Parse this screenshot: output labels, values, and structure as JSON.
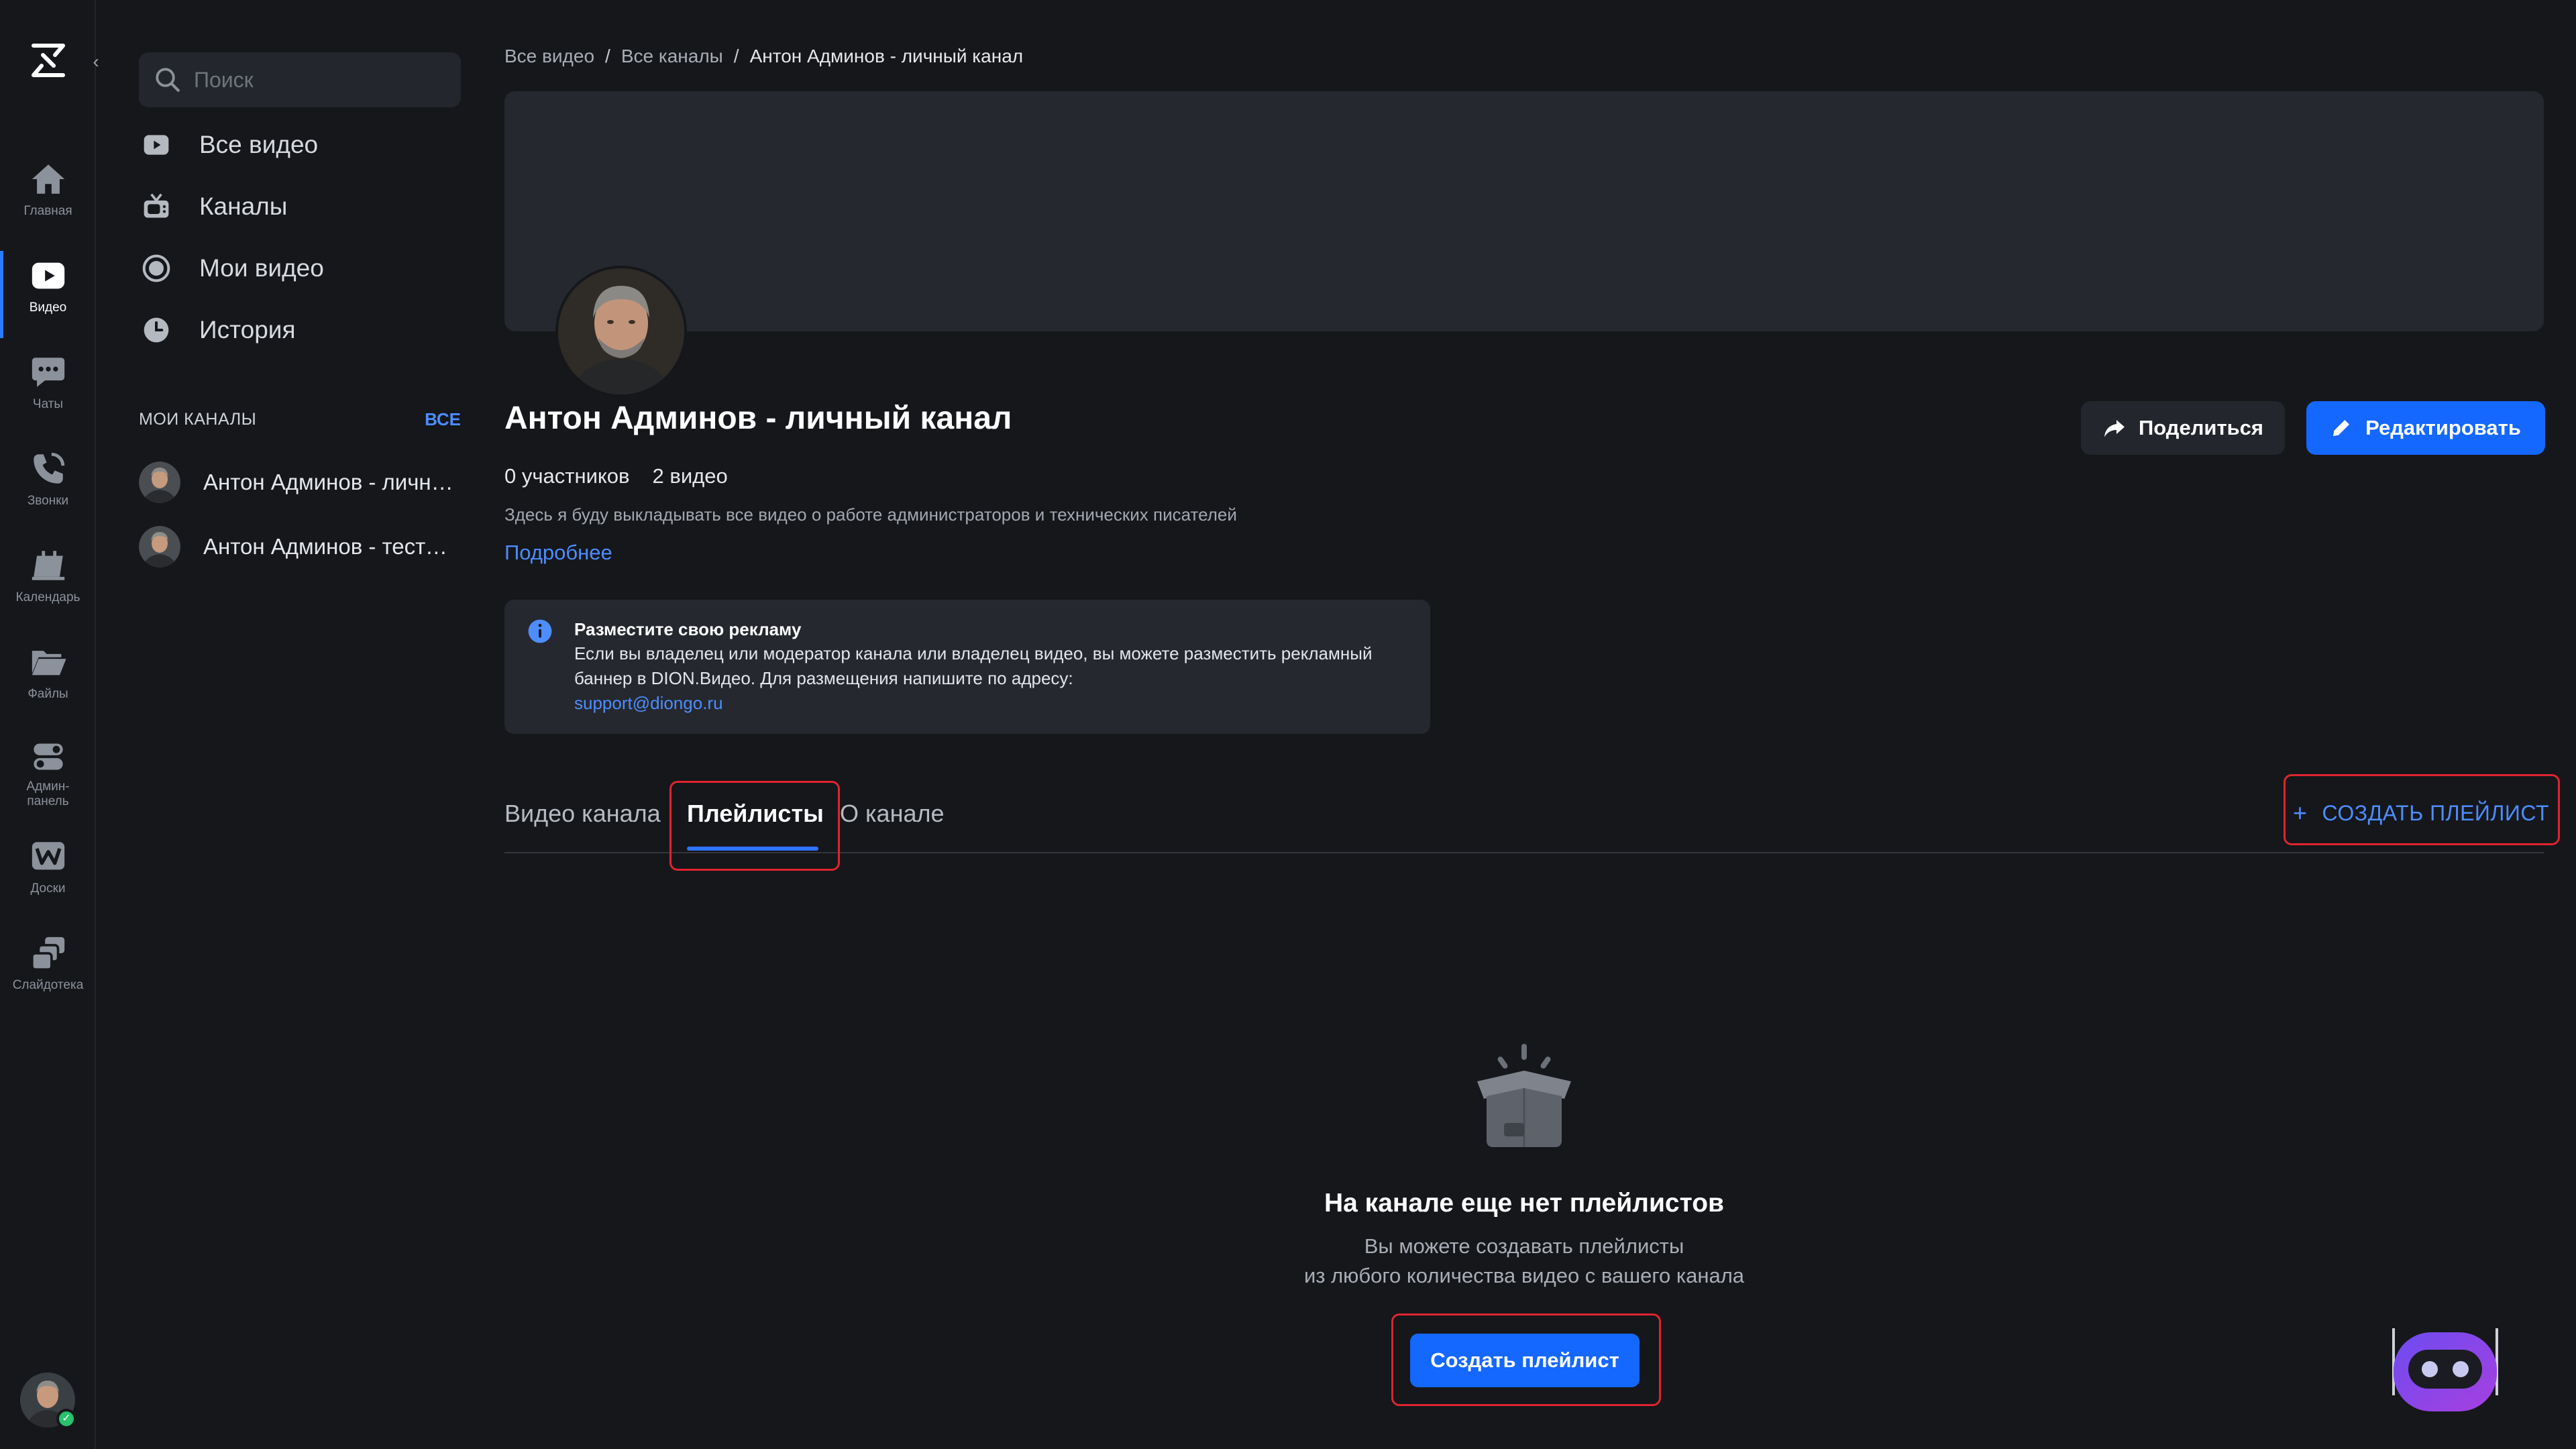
{
  "rail": {
    "items": [
      {
        "label": "Главная",
        "icon": "home-icon"
      },
      {
        "label": "Видео",
        "icon": "video-icon",
        "active": true
      },
      {
        "label": "Чаты",
        "icon": "chat-icon"
      },
      {
        "label": "Звонки",
        "icon": "phone-icon"
      },
      {
        "label": "Календарь",
        "icon": "calendar-icon"
      },
      {
        "label": "Файлы",
        "icon": "folder-icon"
      },
      {
        "label": "Админ-\nпанель",
        "icon": "toggles-icon"
      },
      {
        "label": "Доски",
        "icon": "whiteboard-icon"
      },
      {
        "label": "Слайдотека",
        "icon": "slides-icon"
      }
    ]
  },
  "sidebar": {
    "search_placeholder": "Поиск",
    "nav": [
      {
        "label": "Все видео",
        "icon": "play-square-icon"
      },
      {
        "label": "Каналы",
        "icon": "tv-icon"
      },
      {
        "label": "Мои видео",
        "icon": "record-icon"
      },
      {
        "label": "История",
        "icon": "clock-icon"
      }
    ],
    "my_channels_title": "МОИ КАНАЛЫ",
    "my_channels_all": "ВСЕ",
    "channels": [
      {
        "name": "Антон Админов - личный канал"
      },
      {
        "name": "Антон Админов - тестовый канал"
      }
    ]
  },
  "breadcrumb": [
    "Все видео",
    "Все каналы",
    "Антон Админов - личный канал"
  ],
  "channel": {
    "title": "Антон Админов - личный канал",
    "members": "0 участников",
    "videos": "2 видео",
    "description": "Здесь я буду выкладывать все видео о работе администраторов и технических писателей",
    "more": "Подробнее",
    "share_label": "Поделиться",
    "edit_label": "Редактировать"
  },
  "ad": {
    "title": "Разместите свою рекламу",
    "text": "Если вы владелец или модератор канала или владелец видео, вы можете разместить рекламный баннер в DION.Видео. Для размещения напишите по адресу:",
    "email": "support@diongo.ru"
  },
  "tabs": {
    "items": [
      "Видео канала",
      "Плейлисты",
      "О канале"
    ],
    "active": "Плейлисты",
    "create_link": "СОЗДАТЬ ПЛЕЙЛИСТ"
  },
  "empty": {
    "title": "На канале еще нет плейлистов",
    "line1": "Вы можете создавать плейлисты",
    "line2": "из любого количества видео с вашего канала",
    "button": "Создать плейлист"
  },
  "colors": {
    "accent": "#1467ff",
    "link": "#4d8dff",
    "highlight": "#e0242f",
    "background": "#15171b"
  }
}
